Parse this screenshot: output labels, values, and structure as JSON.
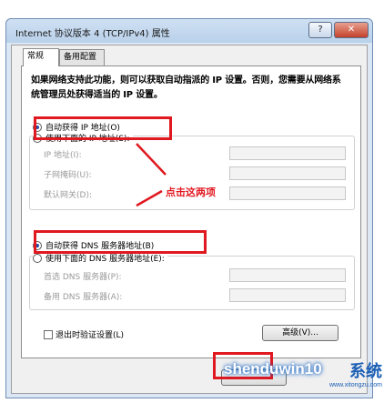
{
  "window": {
    "title": "Internet 协议版本 4 (TCP/IPv4) 属性",
    "help_label": "?",
    "close_label": "✕"
  },
  "tabs": [
    {
      "label": "常规"
    },
    {
      "label": "备用配置"
    }
  ],
  "description": "如果网络支持此功能，则可以获取自动指派的 IP 设置。否则，您需要从网络系统管理员处获得适当的 IP 设置。",
  "ip_section": {
    "auto_label": "自动获得 IP 地址(O)",
    "manual_label": "使用下面的 IP 地址(S):",
    "ip_label": "IP 地址(I):",
    "mask_label": "子网掩码(U):",
    "gateway_label": "默认网关(D):"
  },
  "dns_section": {
    "auto_label": "自动获得 DNS 服务器地址(B)",
    "manual_label": "使用下面的 DNS 服务器地址(E):",
    "preferred_label": "首选 DNS 服务器(P):",
    "alternate_label": "备用 DNS 服务器(A):"
  },
  "annotation": {
    "text": "点击这两项",
    "color": "#e0181f"
  },
  "footer": {
    "validate_label": "退出时验证设置(L)",
    "advanced_label": "高级(V)..."
  },
  "watermark": {
    "brand": "shenduwin10",
    "cn": "系统",
    "sub": "www.xitongzu.com"
  }
}
